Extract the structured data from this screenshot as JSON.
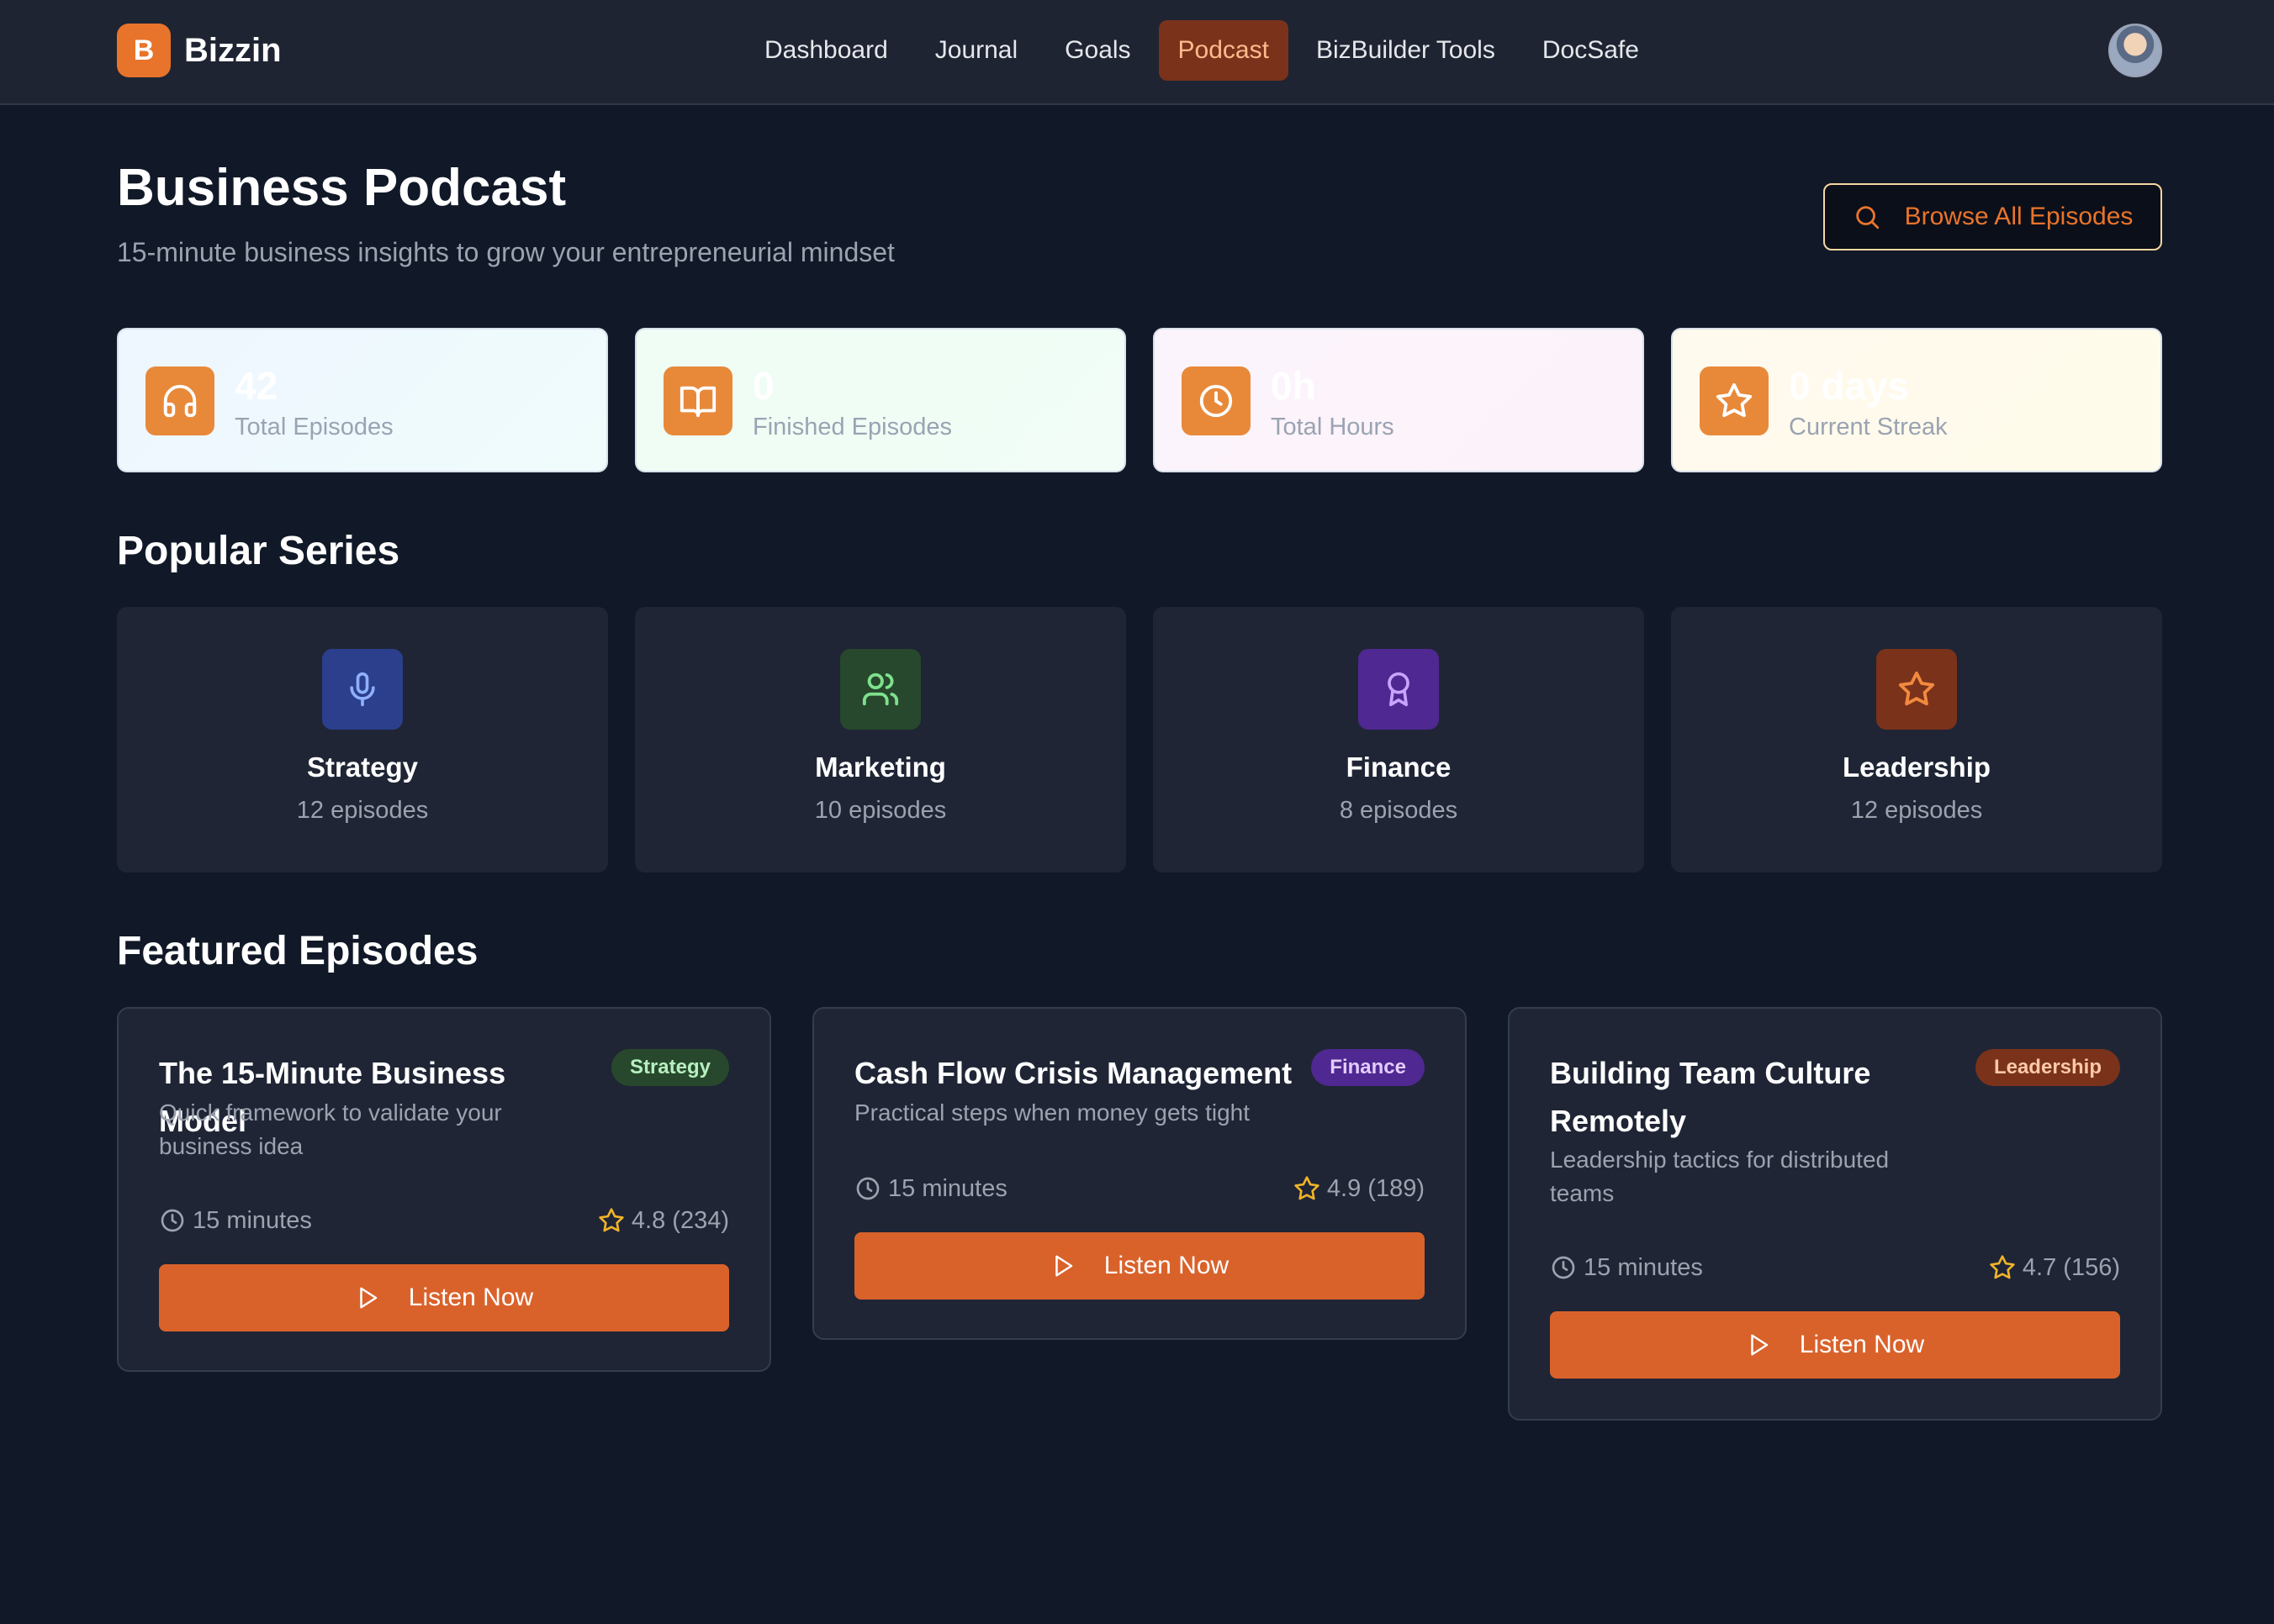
{
  "brand": {
    "logo_letter": "B",
    "name": "Bizzin"
  },
  "nav": {
    "items": [
      {
        "label": "Dashboard",
        "active": false
      },
      {
        "label": "Journal",
        "active": false
      },
      {
        "label": "Goals",
        "active": false
      },
      {
        "label": "Podcast",
        "active": true
      },
      {
        "label": "BizBuilder Tools",
        "active": false
      },
      {
        "label": "DocSafe",
        "active": false
      }
    ],
    "avatar_icon": "user-avatar"
  },
  "header": {
    "title": "Business Podcast",
    "subtitle": "15-minute business insights to grow your entrepreneurial mindset",
    "browse_label": "Browse All Episodes",
    "browse_icon": "search-icon"
  },
  "stats": [
    {
      "value": "42",
      "label": "Total Episodes",
      "icon": "headphones-icon"
    },
    {
      "value": "0",
      "label": "Finished Episodes",
      "icon": "book-open-icon"
    },
    {
      "value": "0h",
      "label": "Total Hours",
      "icon": "clock-icon"
    },
    {
      "value": "0 days",
      "label": "Current Streak",
      "icon": "star-icon"
    }
  ],
  "popular": {
    "title": "Popular Series",
    "items": [
      {
        "name": "Strategy",
        "count": "12 episodes",
        "icon": "microphone-icon",
        "color": "#2b3f8c"
      },
      {
        "name": "Marketing",
        "count": "10 episodes",
        "icon": "users-icon",
        "color": "#27482c"
      },
      {
        "name": "Finance",
        "count": "8 episodes",
        "icon": "award-icon",
        "color": "#4f2891"
      },
      {
        "name": "Leadership",
        "count": "12 episodes",
        "icon": "star-icon",
        "color": "#7a321b"
      }
    ]
  },
  "featured": {
    "title": "Featured Episodes",
    "episodes": [
      {
        "title": "The 15-Minute Business Model",
        "description": "Quick framework to validate your business idea",
        "category": "Strategy",
        "duration": "15 minutes",
        "rating": "4.8 (234)",
        "button": "Listen Now"
      },
      {
        "title": "Cash Flow Crisis Management",
        "description": "Practical steps when money gets tight",
        "category": "Finance",
        "duration": "15 minutes",
        "rating": "4.9 (189)",
        "button": "Listen Now"
      },
      {
        "title": "Building Team Culture Remotely",
        "description": "Leadership tactics for distributed teams",
        "category": "Leadership",
        "duration": "15 minutes",
        "rating": "4.7 (156)",
        "button": "Listen Now"
      }
    ]
  },
  "colors": {
    "accent": "#d9622b",
    "background": "#111827",
    "card": "#1f2535"
  }
}
